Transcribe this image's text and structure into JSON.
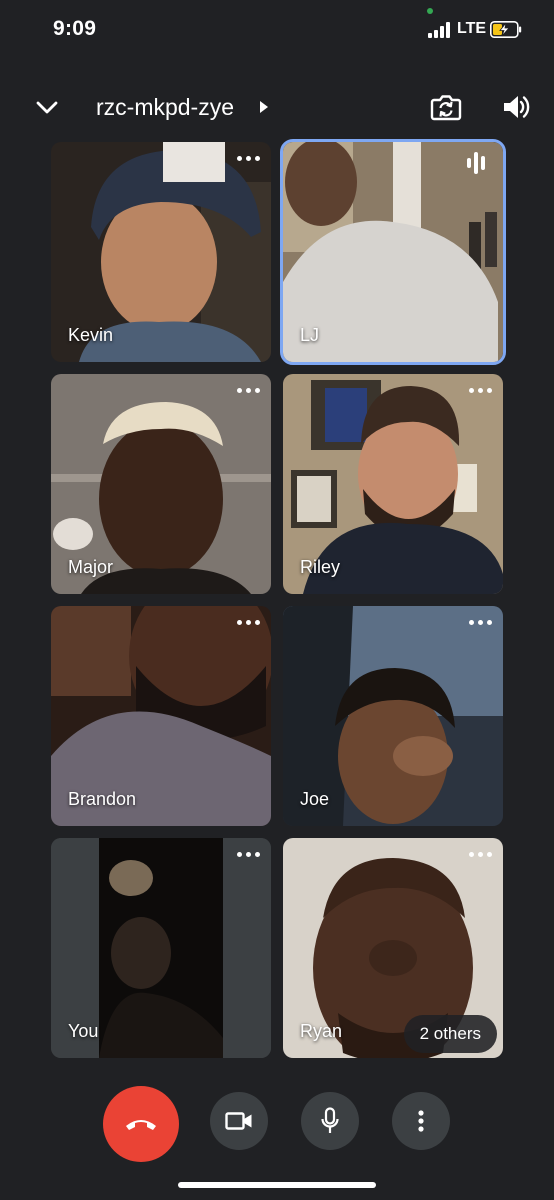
{
  "status_bar": {
    "time": "9:09",
    "network": "LTE",
    "icons": [
      "camera-in-use-dot",
      "signal-icon",
      "battery-charging-icon"
    ]
  },
  "header": {
    "meeting_code": "rzc-mkpd-zye",
    "icons": [
      "chevron-down-icon",
      "caret-right-icon",
      "flip-camera-icon",
      "speaker-icon"
    ]
  },
  "participants": [
    {
      "name": "Kevin"
    },
    {
      "name": "LJ",
      "speaking": true
    },
    {
      "name": "Major"
    },
    {
      "name": "Riley"
    },
    {
      "name": "Brandon"
    },
    {
      "name": "Joe"
    },
    {
      "name": "You"
    },
    {
      "name": "Ryan"
    }
  ],
  "others_label": "2 others",
  "controls": {
    "buttons": [
      "hang-up",
      "camera",
      "microphone",
      "more-options"
    ]
  },
  "colors": {
    "background": "#202124",
    "active_outline": "#7ea7f2",
    "hangup": "#ea4335",
    "control_bg": "#3c4043",
    "status_green": "#34a853",
    "battery_yellow": "#f5c518"
  }
}
